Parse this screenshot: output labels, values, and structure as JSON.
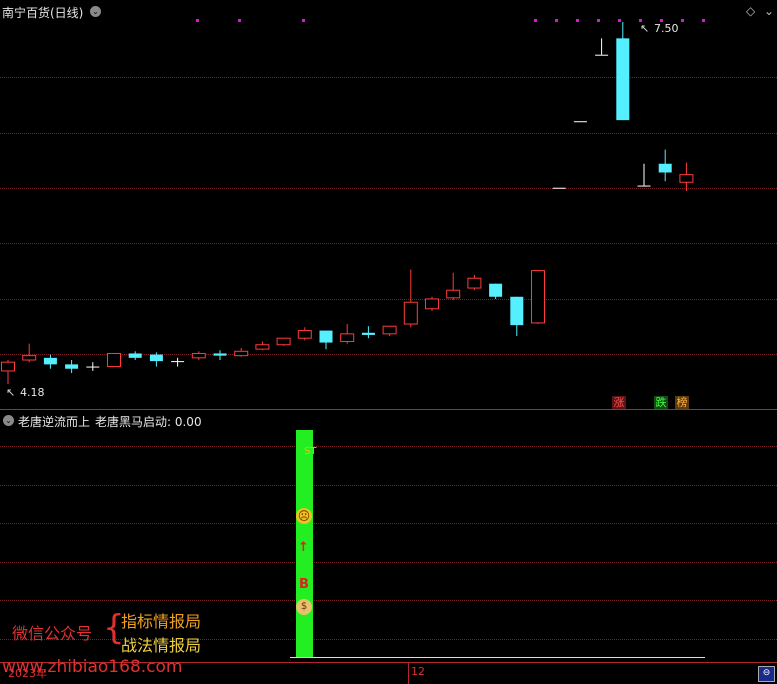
{
  "main_panel": {
    "title": "南宁百货(日线)",
    "price_high_label": "7.50",
    "price_low_label": "4.18",
    "badges": {
      "zhang": "涨",
      "die": "跌",
      "bang": "榜"
    }
  },
  "indicator_panel": {
    "title": "老唐逆流而上",
    "value_label": "老唐黑马启动: 0.00",
    "bar_text": "ST",
    "marker_b": "B",
    "marker_up_arrow": "↑"
  },
  "watermark": {
    "wechat_label": "微信公众号",
    "brace": "{",
    "line1": "指标情报局",
    "line2": "战法情报局",
    "url": "www.zhibiao168.com"
  },
  "time_axis": {
    "year_label": "2023年",
    "month_label": "12"
  },
  "colors": {
    "up": "#ff3b3b",
    "down": "#54f0ff",
    "grid": "#7a1f24",
    "bar_green": "#22ee22"
  },
  "chart_data": {
    "type": "candlestick",
    "candles": [
      {
        "o": 4.3,
        "c": 4.38,
        "h": 4.4,
        "l": 4.18
      },
      {
        "o": 4.4,
        "c": 4.44,
        "h": 4.55,
        "l": 4.38
      },
      {
        "o": 4.42,
        "c": 4.36,
        "h": 4.45,
        "l": 4.32
      },
      {
        "o": 4.36,
        "c": 4.32,
        "h": 4.4,
        "l": 4.28
      },
      {
        "o": 4.34,
        "c": 4.34,
        "h": 4.38,
        "l": 4.3
      },
      {
        "o": 4.34,
        "c": 4.46,
        "h": 4.46,
        "l": 4.34
      },
      {
        "o": 4.46,
        "c": 4.42,
        "h": 4.48,
        "l": 4.4
      },
      {
        "o": 4.45,
        "c": 4.39,
        "h": 4.47,
        "l": 4.34
      },
      {
        "o": 4.39,
        "c": 4.39,
        "h": 4.42,
        "l": 4.34
      },
      {
        "o": 4.42,
        "c": 4.46,
        "h": 4.48,
        "l": 4.4
      },
      {
        "o": 4.46,
        "c": 4.44,
        "h": 4.49,
        "l": 4.4
      },
      {
        "o": 4.44,
        "c": 4.48,
        "h": 4.51,
        "l": 4.43
      },
      {
        "o": 4.5,
        "c": 4.54,
        "h": 4.57,
        "l": 4.49
      },
      {
        "o": 4.54,
        "c": 4.6,
        "h": 4.6,
        "l": 4.53
      },
      {
        "o": 4.6,
        "c": 4.67,
        "h": 4.7,
        "l": 4.58
      },
      {
        "o": 4.67,
        "c": 4.56,
        "h": 4.67,
        "l": 4.5
      },
      {
        "o": 4.57,
        "c": 4.64,
        "h": 4.73,
        "l": 4.55
      },
      {
        "o": 4.65,
        "c": 4.63,
        "h": 4.71,
        "l": 4.6
      },
      {
        "o": 4.64,
        "c": 4.71,
        "h": 4.71,
        "l": 4.62
      },
      {
        "o": 4.73,
        "c": 4.93,
        "h": 5.23,
        "l": 4.7
      },
      {
        "o": 4.87,
        "c": 4.96,
        "h": 4.98,
        "l": 4.85
      },
      {
        "o": 4.97,
        "c": 5.04,
        "h": 5.2,
        "l": 4.95
      },
      {
        "o": 5.06,
        "c": 5.15,
        "h": 5.18,
        "l": 5.04
      },
      {
        "o": 5.1,
        "c": 4.98,
        "h": 5.1,
        "l": 4.96
      },
      {
        "o": 4.98,
        "c": 4.72,
        "h": 4.98,
        "l": 4.62
      },
      {
        "o": 4.74,
        "c": 5.22,
        "h": 5.22,
        "l": 4.73
      },
      {
        "o": 5.98,
        "c": 5.98,
        "h": 5.98,
        "l": 5.98
      },
      {
        "o": 6.59,
        "c": 6.59,
        "h": 6.59,
        "l": 6.59
      },
      {
        "o": 7.2,
        "c": 7.2,
        "h": 7.35,
        "l": 7.2
      },
      {
        "o": 7.35,
        "c": 6.6,
        "h": 7.5,
        "l": 6.6
      },
      {
        "o": 6.0,
        "c": 6.0,
        "h": 6.2,
        "l": 6.0
      },
      {
        "o": 6.2,
        "c": 6.12,
        "h": 6.33,
        "l": 6.04
      },
      {
        "o": 6.03,
        "c": 6.1,
        "h": 6.21,
        "l": 5.95
      }
    ]
  }
}
